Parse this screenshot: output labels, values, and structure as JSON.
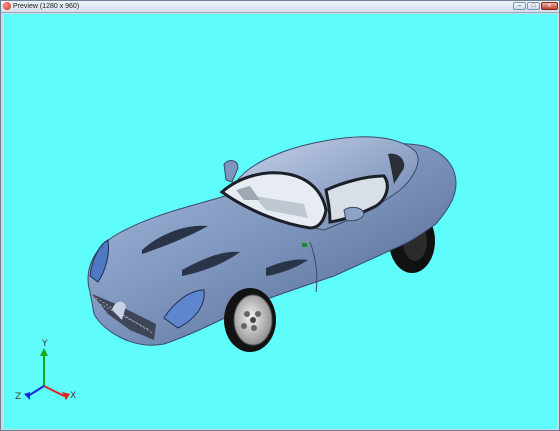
{
  "window": {
    "title": "Preview (1280 x 960)",
    "controls": {
      "minimize": "–",
      "maximize": "□",
      "close": "x"
    }
  },
  "viewport": {
    "background": "#5ffcfc",
    "axes": {
      "x": "X",
      "y": "Y",
      "z": "Z"
    },
    "axis_colors": {
      "x": "#e0201a",
      "y": "#1aa81a",
      "z": "#1a2ae0"
    }
  },
  "car": {
    "body_color": "#7f97bf"
  }
}
